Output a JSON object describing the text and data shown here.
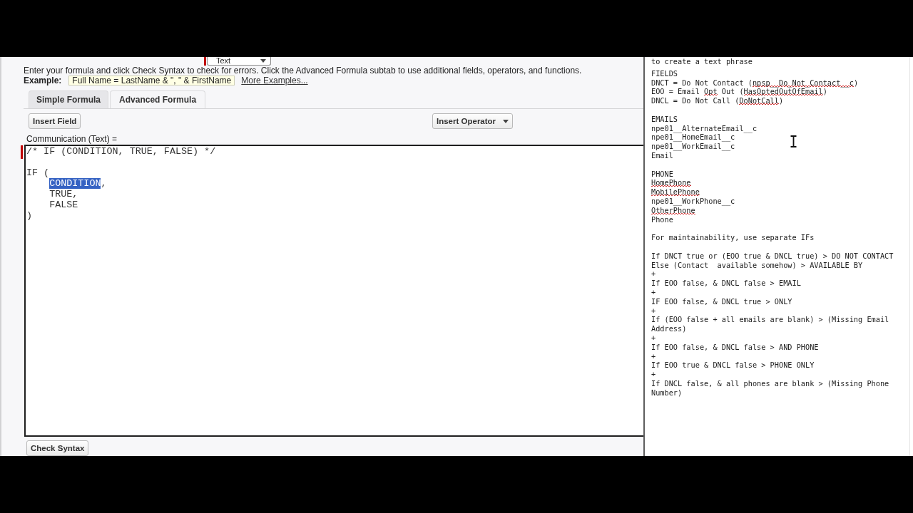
{
  "formula": {
    "type_select": {
      "value": "Text",
      "required": true
    },
    "instructions": "Enter your formula and click Check Syntax to check for errors. Click the Advanced Formula subtab to use additional fields, operators, and functions.",
    "example_label": "Example:",
    "example": "Full Name = LastName & \", \" & FirstName",
    "more_examples": "More Examples...",
    "tabs": [
      {
        "label": "Simple Formula",
        "selected": false
      },
      {
        "label": "Advanced Formula",
        "selected": true
      }
    ],
    "buttons": {
      "insert_field": "Insert Field",
      "insert_operator": "Insert Operator"
    },
    "editor": {
      "label": "Communication (Text) =",
      "required": true,
      "value_parts": [
        {
          "text": "/* IF (CONDITION, TRUE, FALSE) */\n\nIF (\n    ",
          "selected": false
        },
        {
          "text": "CONDITION",
          "selected": true
        },
        {
          "text": ",\n    TRUE,\n    FALSE\n)",
          "selected": false
        }
      ]
    },
    "check_syntax": "Check Syntax"
  },
  "notes": {
    "cut_line": "to create a text phrase",
    "blocks": [
      {
        "lines": [
          {
            "text": "FIELDS"
          },
          {
            "parts": [
              {
                "text": "DNCT = Do Not Contact (",
                "misspelled": false
              },
              {
                "text": "npsp__Do_Not_Contact__c",
                "misspelled": true
              },
              {
                "text": ")",
                "misspelled": false
              }
            ]
          },
          {
            "parts": [
              {
                "text": "EOO = Email ",
                "misspelled": false
              },
              {
                "text": "Opt",
                "misspelled": true
              },
              {
                "text": " Out (",
                "misspelled": false
              },
              {
                "text": "HasOptedOutOfEmail",
                "misspelled": true
              },
              {
                "text": ")",
                "misspelled": false
              }
            ]
          },
          {
            "parts": [
              {
                "text": "DNCL = Do Not Call (",
                "misspelled": false
              },
              {
                "text": "DoNotCall",
                "misspelled": true
              },
              {
                "text": ")",
                "misspelled": false
              }
            ]
          }
        ]
      },
      {
        "lines": [
          {
            "text": "EMAILS"
          },
          {
            "text": "npe01__AlternateEmail__c"
          },
          {
            "text": "npe01__HomeEmail__c"
          },
          {
            "text": "npe01__WorkEmail__c"
          },
          {
            "text": "Email"
          }
        ]
      },
      {
        "lines": [
          {
            "text": "PHONE"
          },
          {
            "parts": [
              {
                "text": "HomePhone",
                "misspelled": true
              }
            ]
          },
          {
            "parts": [
              {
                "text": "MobilePhone",
                "misspelled": true
              }
            ]
          },
          {
            "text": "npe01__WorkPhone__c"
          },
          {
            "parts": [
              {
                "text": "OtherPhone",
                "misspelled": true
              }
            ]
          },
          {
            "text": "Phone"
          }
        ]
      },
      {
        "lines": [
          {
            "text": "For maintainability, use separate IFs"
          }
        ]
      },
      {
        "lines": [
          {
            "text": "If DNCT true or (EOO true & DNCL true) > DO NOT CONTACT"
          },
          {
            "text": "Else (Contact  available somehow) > AVAILABLE BY"
          },
          {
            "text": "+"
          },
          {
            "text": "If EOO false, & DNCL false > EMAIL"
          },
          {
            "text": "+"
          },
          {
            "text": "IF EOO false, & DNCL true > ONLY"
          },
          {
            "text": "+"
          },
          {
            "text": "If (EOO false + all emails are blank) > (Missing Email Address)"
          },
          {
            "text": "+"
          },
          {
            "text": "If EOO false, & DNCL false > AND PHONE"
          },
          {
            "text": "+"
          },
          {
            "text": "If EOO true & DNCL false > PHONE ONLY"
          },
          {
            "text": "+"
          },
          {
            "text": "If DNCL false, & all phones are blank > (Missing Phone Number)"
          }
        ]
      }
    ]
  }
}
